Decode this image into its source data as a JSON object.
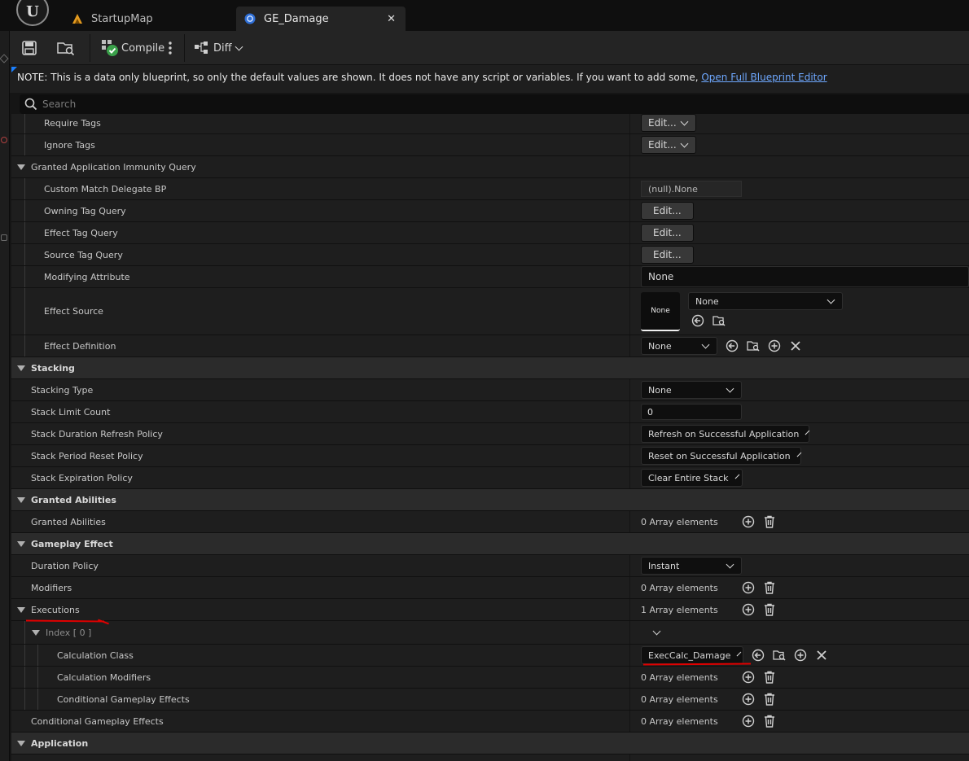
{
  "tabs": [
    {
      "label": "StartupMap"
    },
    {
      "label": "GE_Damage"
    }
  ],
  "toolbar": {
    "compile_label": "Compile",
    "diff_label": "Diff"
  },
  "note": {
    "text": "NOTE: This is a data only blueprint, so only the default values are shown.  It does not have any script or variables.  If you want to add some, ",
    "link": "Open Full Blueprint Editor"
  },
  "search": {
    "placeholder": "Search"
  },
  "rows": {
    "require_tags": {
      "label": "Require Tags",
      "value": "Edit..."
    },
    "ignore_tags": {
      "label": "Ignore Tags",
      "value": "Edit..."
    },
    "immunity_query": {
      "label": "Granted Application Immunity Query"
    },
    "custom_match": {
      "label": "Custom Match Delegate BP",
      "value": "(null).None"
    },
    "owning_tag_query": {
      "label": "Owning Tag Query",
      "value": "Edit..."
    },
    "effect_tag_query": {
      "label": "Effect Tag Query",
      "value": "Edit..."
    },
    "source_tag_query": {
      "label": "Source Tag Query",
      "value": "Edit..."
    },
    "modifying_attribute": {
      "label": "Modifying Attribute",
      "value": "None"
    },
    "effect_source": {
      "label": "Effect Source",
      "thumb": "None",
      "value": "None"
    },
    "effect_definition": {
      "label": "Effect Definition",
      "value": "None"
    },
    "stacking": {
      "label": "Stacking"
    },
    "stacking_type": {
      "label": "Stacking Type",
      "value": "None"
    },
    "stack_limit": {
      "label": "Stack Limit Count",
      "value": "0"
    },
    "stack_refresh": {
      "label": "Stack Duration Refresh Policy",
      "value": "Refresh on Successful Application"
    },
    "stack_period": {
      "label": "Stack Period Reset Policy",
      "value": "Reset on Successful Application"
    },
    "stack_expiration": {
      "label": "Stack Expiration Policy",
      "value": "Clear Entire Stack"
    },
    "granted_abilities_cat": {
      "label": "Granted Abilities"
    },
    "granted_abilities": {
      "label": "Granted Abilities",
      "value": "0 Array elements"
    },
    "gameplay_effect": {
      "label": "Gameplay Effect"
    },
    "duration_policy": {
      "label": "Duration Policy",
      "value": "Instant"
    },
    "modifiers": {
      "label": "Modifiers",
      "value": "0 Array elements"
    },
    "executions": {
      "label": "Executions",
      "value": "1 Array elements"
    },
    "index0": {
      "label": "Index [ 0 ]"
    },
    "calc_class": {
      "label": "Calculation Class",
      "value": "ExecCalc_Damage"
    },
    "calc_modifiers": {
      "label": "Calculation Modifiers",
      "value": "0 Array elements"
    },
    "cond_effects_inner": {
      "label": "Conditional Gameplay Effects",
      "value": "0 Array elements"
    },
    "cond_effects": {
      "label": "Conditional Gameplay Effects",
      "value": "0 Array elements"
    },
    "application": {
      "label": "Application"
    }
  },
  "colors": {
    "accent": "#1b80ff",
    "annotation": "#e00000",
    "link": "#6ea8ff"
  }
}
